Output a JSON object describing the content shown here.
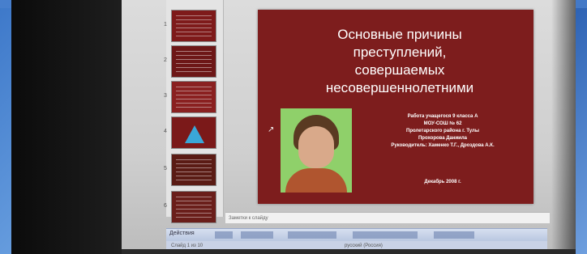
{
  "slide": {
    "header": "",
    "title_lines": [
      "Основные причины",
      "преступлений,",
      "совершаемых",
      "несовершеннолетними"
    ],
    "info_lines": [
      "Работа учащегося 9 класса А",
      "МОУ-СОШ № 62",
      "Пролетарского района г. Тулы",
      "Прохорова Даниила",
      "Руководитель: Хаменко Т.Г., Дроздова А.К."
    ],
    "date": "Декабрь 2008 г."
  },
  "thumbnails": [
    {
      "number": "1"
    },
    {
      "number": "2"
    },
    {
      "number": "3"
    },
    {
      "number": "4"
    },
    {
      "number": "5"
    },
    {
      "number": "6"
    }
  ],
  "notes_placeholder": "Заметки к слайду",
  "toolbar": {
    "draw_label": "Действия"
  },
  "statusbar": {
    "slide_info": "Слайд 1 из 10",
    "language": "русский (Россия)"
  },
  "colors": {
    "slide_bg": "#7d1d1d",
    "photo_bg": "#8fd06a",
    "backdrop": "#3d78c9"
  }
}
